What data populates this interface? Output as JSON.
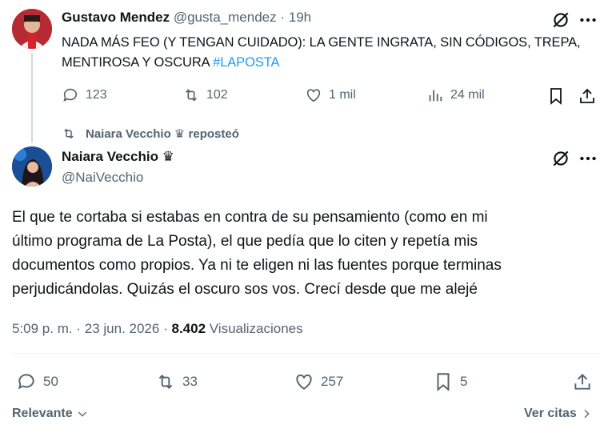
{
  "quoted_tweet": {
    "name": "Gustavo Mendez",
    "handle": "@gusta_mendez",
    "separator": "·",
    "time": "19h",
    "text_plain": "NADA MÁS FEO (Y TENGAN CUIDADO): LA GENTE INGRATA, SIN CÓDIGOS, TREPA, MENTIROSA Y OSCURA ",
    "hashtag": "#LAPOSTA",
    "stats": {
      "replies": "123",
      "retweets": "102",
      "likes": "1 mil",
      "views": "24 mil"
    }
  },
  "repost_banner": {
    "text": "Naiara Vecchio ♛ reposteó"
  },
  "main_tweet": {
    "name": "Naiara Vecchio ♛",
    "handle": "@NaiVecchio",
    "body_lines": [
      "El que te cortaba si estabas en contra de su pensamiento (como en mi",
      "último programa de La Posta), el que pedía que lo citen y repetía mis",
      "documentos como propios. Ya ni te eligen ni las fuentes porque terminas",
      "perjudicándolas. Quizás el oscuro sos vos. Crecí desde que me alejé"
    ],
    "meta": {
      "time": "5:09 p. m.",
      "separator": "·",
      "date": "23 jun. 2026",
      "views_count": "8.402",
      "views_label": "Visualizaciones"
    },
    "actions": {
      "replies": "50",
      "retweets": "33",
      "likes": "257",
      "bookmarks": "5"
    }
  },
  "footer": {
    "sort_label": "Relevante",
    "quotes_label": "Ver citas"
  }
}
